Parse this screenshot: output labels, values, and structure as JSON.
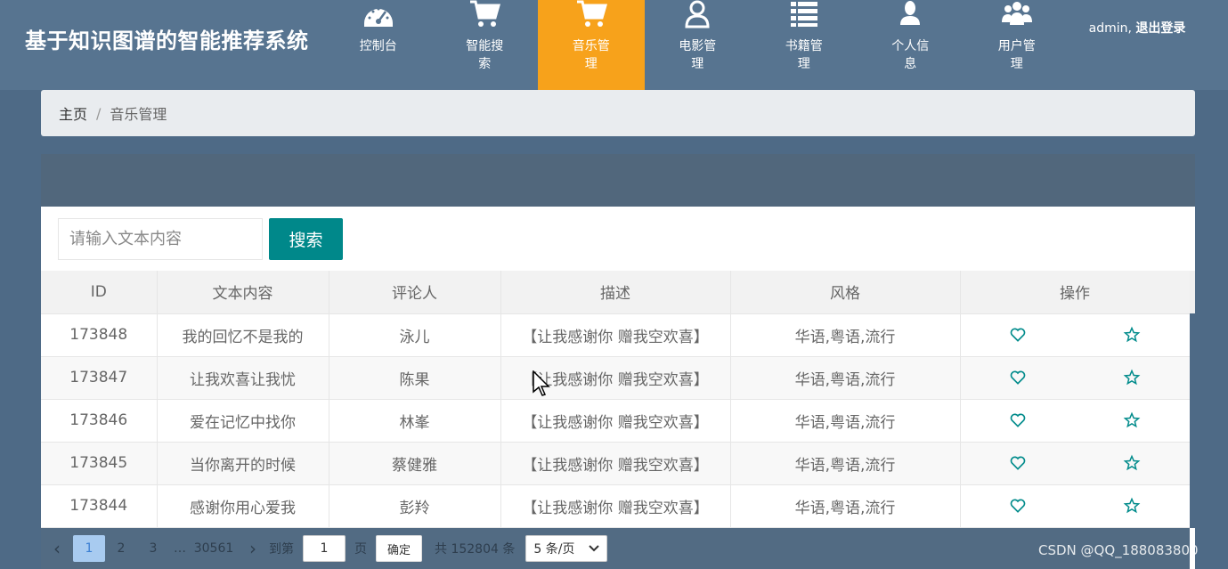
{
  "header": {
    "app_title": "基于知识图谱的智能推荐系统",
    "nav": [
      {
        "label": "控制台",
        "icon": "dashboard-gauge-icon",
        "active": false
      },
      {
        "label": "智能搜索",
        "icon": "shopping-cart-icon",
        "active": false
      },
      {
        "label": "音乐管理",
        "icon": "shopping-cart-icon",
        "active": true
      },
      {
        "label": "电影管理",
        "icon": "user-outline-icon",
        "active": false
      },
      {
        "label": "书籍管理",
        "icon": "list-icon",
        "active": false
      },
      {
        "label": "个人信息",
        "icon": "user-icon",
        "active": false
      },
      {
        "label": "用户管理",
        "icon": "users-icon",
        "active": false
      }
    ],
    "user": "admin,",
    "logout_label": "退出登录"
  },
  "breadcrumb": {
    "home": "主页",
    "separator": "/",
    "current": "音乐管理"
  },
  "search": {
    "placeholder": "请输入文本内容",
    "button": "搜索"
  },
  "table": {
    "columns": [
      "ID",
      "文本内容",
      "评论人",
      "描述",
      "风格",
      "操作"
    ],
    "rows": [
      {
        "id": "173848",
        "text": "我的回忆不是我的",
        "reviewer": "泳儿",
        "desc": "【让我感谢你 赠我空欢喜】",
        "style": "华语,粤语,流行"
      },
      {
        "id": "173847",
        "text": "让我欢喜让我忧",
        "reviewer": "陈果",
        "desc": "【让我感谢你 赠我空欢喜】",
        "style": "华语,粤语,流行"
      },
      {
        "id": "173846",
        "text": "爱在记忆中找你",
        "reviewer": "林峯",
        "desc": "【让我感谢你 赠我空欢喜】",
        "style": "华语,粤语,流行"
      },
      {
        "id": "173845",
        "text": "当你离开的时候",
        "reviewer": "蔡健雅",
        "desc": "【让我感谢你 赠我空欢喜】",
        "style": "华语,粤语,流行"
      },
      {
        "id": "173844",
        "text": "感谢你用心爱我",
        "reviewer": "彭羚",
        "desc": "【让我感谢你 赠我空欢喜】",
        "style": "华语,粤语,流行"
      }
    ],
    "action_icons": [
      "heart-icon",
      "star-icon"
    ]
  },
  "pagination": {
    "pages": [
      "1",
      "2",
      "3"
    ],
    "current": "1",
    "ellipsis": "…",
    "last_page": "30561",
    "goto_label": "到第",
    "goto_value": "1",
    "page_unit": "页",
    "confirm": "确定",
    "total": "共 152804 条",
    "page_size": "5 条/页"
  },
  "watermark": "CSDN @QQ_188083800",
  "colors": {
    "header_bg": "#577490",
    "active_nav": "#f7a21b",
    "search_button": "#00888a",
    "icon_teal": "#008b8b"
  }
}
